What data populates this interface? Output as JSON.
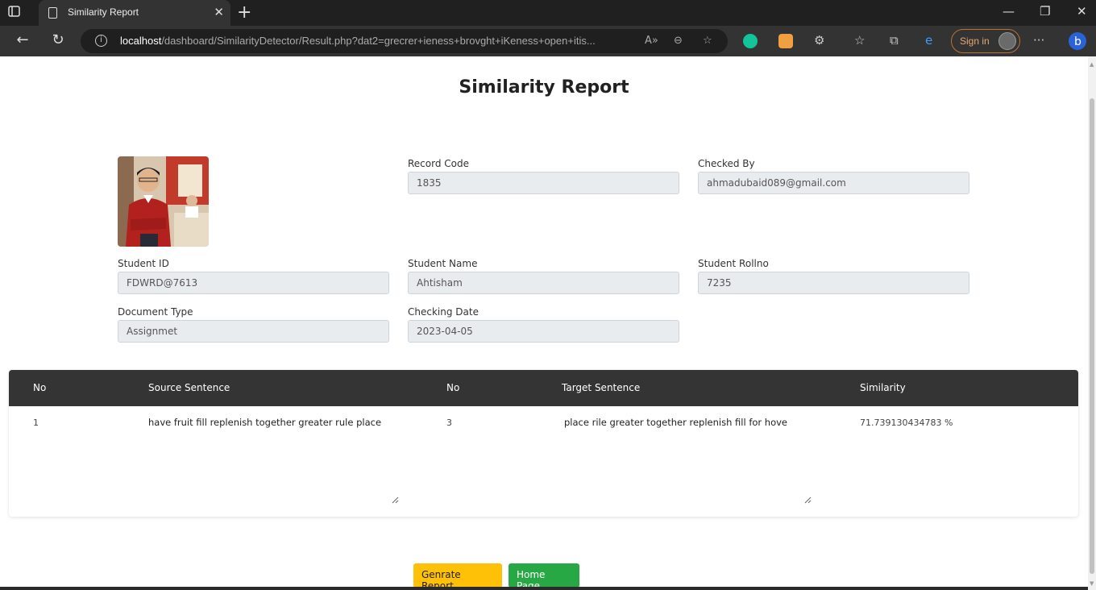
{
  "browser": {
    "tab_title": "Similarity Report",
    "url_host": "localhost",
    "url_path": "/dashboard/SimilarityDetector/Result.php?dat2=grecrer+ieness+brovght+iKeness+open+itis...",
    "sign_in_label": "Sign in"
  },
  "page": {
    "title": "Similarity Report"
  },
  "fields": {
    "record_code": {
      "label": "Record Code",
      "value": "1835"
    },
    "checked_by": {
      "label": "Checked By",
      "value": "ahmadubaid089@gmail.com"
    },
    "student_id": {
      "label": "Student ID",
      "value": "FDWRD@7613"
    },
    "student_name": {
      "label": "Student Name",
      "value": "Ahtisham"
    },
    "student_rollno": {
      "label": "Student Rollno",
      "value": "7235"
    },
    "document_type": {
      "label": "Document Type",
      "value": "Assignmet"
    },
    "checking_date": {
      "label": "Checking Date",
      "value": "2023-04-05"
    }
  },
  "table": {
    "headers": [
      "No",
      "Source Sentence",
      "No",
      "Target Sentence",
      "Similarity"
    ],
    "rows": [
      {
        "source_no": "1",
        "source_sentence": "have fruit fill replenish together greater rule place",
        "target_no": "3",
        "target_sentence": "place rile greater together replenish fill for hove",
        "similarity": "71.739130434783 %"
      }
    ]
  },
  "buttons": {
    "generate_report": "Genrate Report",
    "home_page": "Home Page"
  },
  "colors": {
    "table_header": "#343434",
    "warning_button": "#ffc107",
    "success_button": "#28a745",
    "field_bg": "#e9ecef"
  }
}
